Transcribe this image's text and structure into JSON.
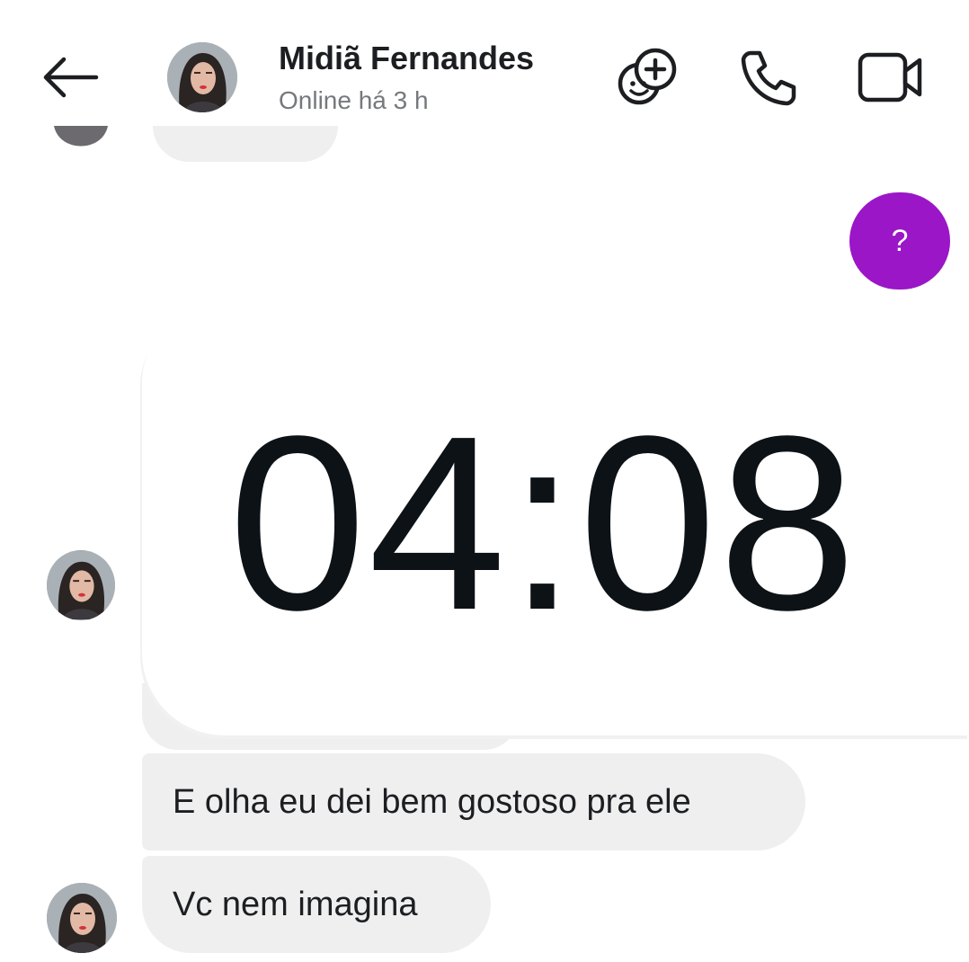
{
  "header": {
    "back_icon": "arrow-left-icon",
    "contact_name": "Midiã Fernandes",
    "status": "Online há 3 h",
    "effects_icon": "effects-add-icon",
    "call_icon": "phone-icon",
    "video_icon": "video-camera-icon"
  },
  "messages": {
    "outgoing": {
      "text": "?",
      "color": "#9b16c7"
    },
    "image_message": {
      "time_text": "04:08"
    },
    "incoming": [
      {
        "text": "E olha eu dei bem gostoso pra ele"
      },
      {
        "text": "Vc nem imagina"
      }
    ]
  },
  "colors": {
    "accent": "#9b16c7",
    "incoming_bubble": "#efefef",
    "status_text": "#75797d"
  }
}
